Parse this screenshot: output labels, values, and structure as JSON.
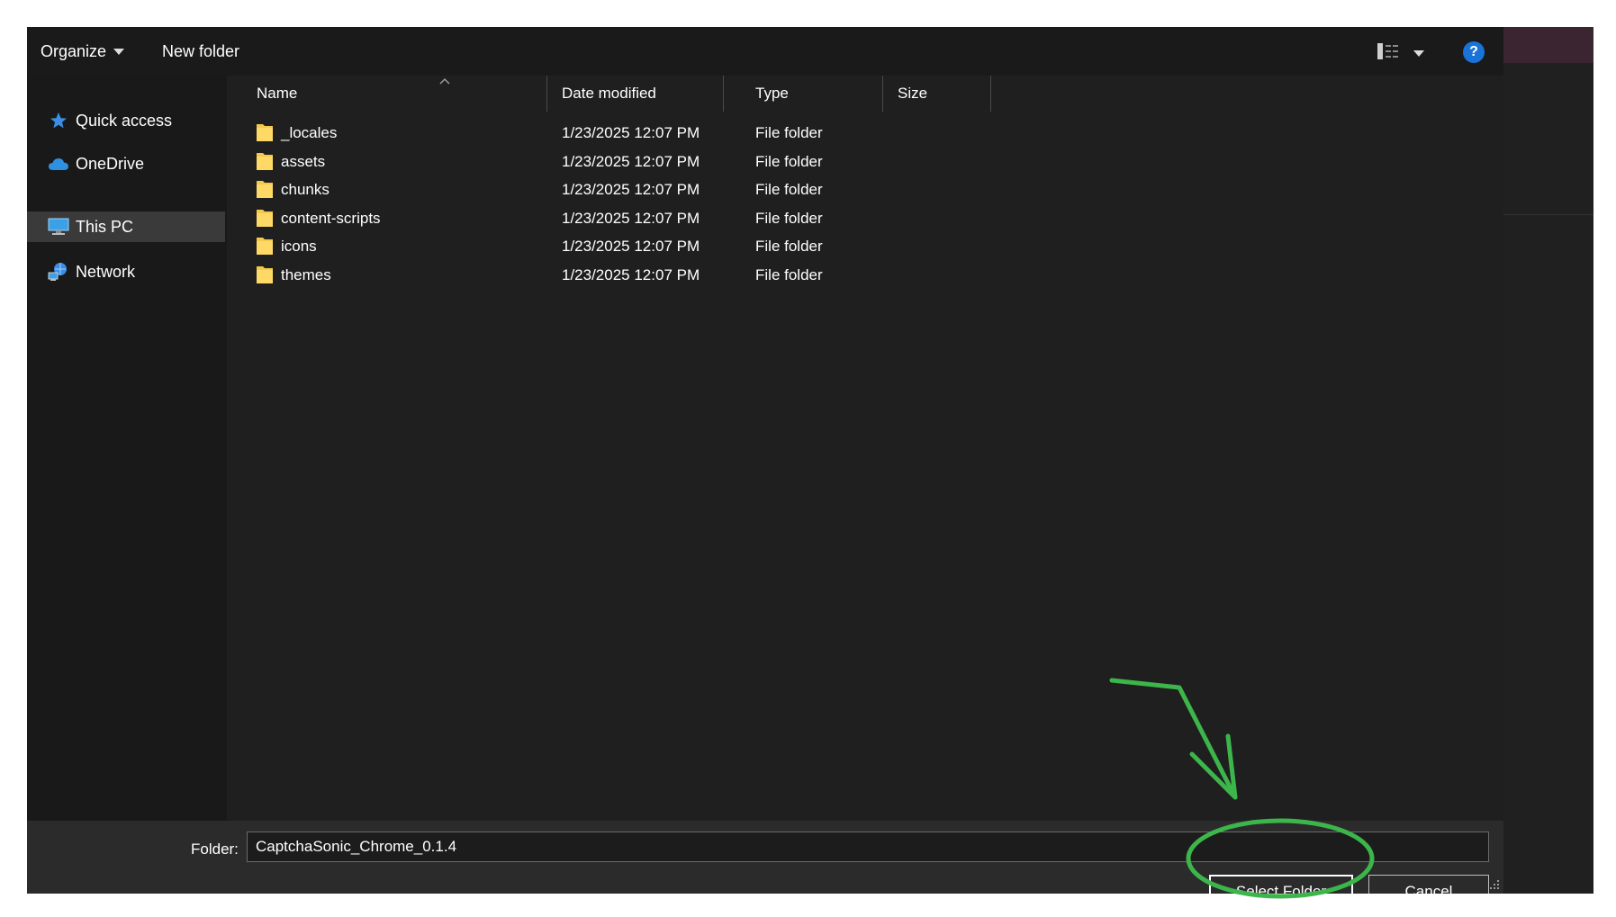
{
  "toolbar": {
    "organize_label": "Organize",
    "new_folder_label": "New folder",
    "view_icon": "details-view-icon",
    "help_label": "?"
  },
  "nav": {
    "items": [
      {
        "label": "Quick access",
        "icon": "star-icon",
        "selected": false
      },
      {
        "label": "OneDrive",
        "icon": "cloud-icon",
        "selected": false
      },
      {
        "label": "This PC",
        "icon": "computer-icon",
        "selected": true
      },
      {
        "label": "Network",
        "icon": "network-icon",
        "selected": false
      }
    ]
  },
  "columns": {
    "name": "Name",
    "date_modified": "Date modified",
    "type": "Type",
    "size": "Size"
  },
  "files": [
    {
      "name": "_locales",
      "date": "1/23/2025 12:07 PM",
      "type": "File folder"
    },
    {
      "name": "assets",
      "date": "1/23/2025 12:07 PM",
      "type": "File folder"
    },
    {
      "name": "chunks",
      "date": "1/23/2025 12:07 PM",
      "type": "File folder"
    },
    {
      "name": "content-scripts",
      "date": "1/23/2025 12:07 PM",
      "type": "File folder"
    },
    {
      "name": "icons",
      "date": "1/23/2025 12:07 PM",
      "type": "File folder"
    },
    {
      "name": "themes",
      "date": "1/23/2025 12:07 PM",
      "type": "File folder"
    }
  ],
  "footer": {
    "folder_label": "Folder:",
    "folder_value": "CaptchaSonic_Chrome_0.1.4",
    "select_label": "Select Folder",
    "cancel_label": "Cancel"
  },
  "colors": {
    "annotation": "#3cb54a",
    "folder": "#f5c94c",
    "help_blue": "#1a73d9"
  }
}
